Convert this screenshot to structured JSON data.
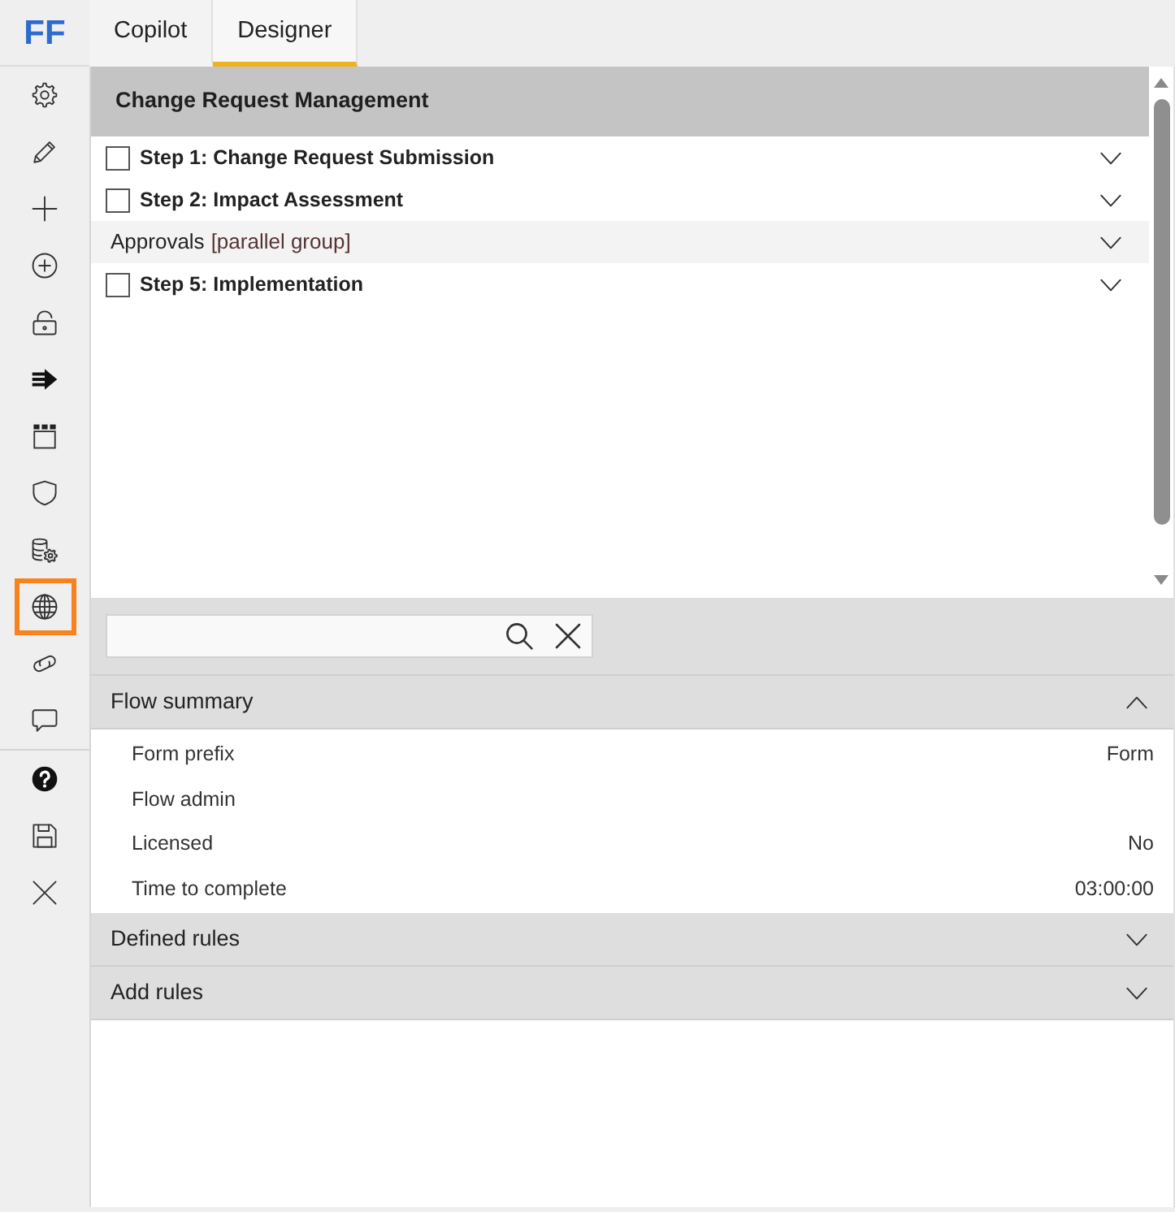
{
  "logo": {
    "text": "FF"
  },
  "tabs": [
    {
      "label": "Copilot",
      "selected": false
    },
    {
      "label": "Designer",
      "selected": true
    }
  ],
  "sidebar": {
    "groups": [
      {
        "items": [
          {
            "kind": "settings",
            "selected": false
          },
          {
            "kind": "edit",
            "selected": false
          },
          {
            "kind": "add",
            "selected": false
          },
          {
            "kind": "insert",
            "selected": false
          },
          {
            "kind": "unlock",
            "selected": false
          },
          {
            "kind": "forward",
            "selected": false
          },
          {
            "kind": "calendar",
            "selected": false
          },
          {
            "kind": "shield",
            "selected": false
          },
          {
            "kind": "database",
            "selected": false
          },
          {
            "kind": "globe",
            "selected": true
          },
          {
            "kind": "link",
            "selected": false
          },
          {
            "kind": "comment",
            "selected": false
          }
        ]
      },
      {
        "items": [
          {
            "kind": "help",
            "selected": false
          },
          {
            "kind": "save",
            "selected": false
          },
          {
            "kind": "close",
            "selected": false
          }
        ]
      }
    ]
  },
  "flow": {
    "title": "Change Request Management",
    "items": [
      {
        "kind": "step",
        "label": "Step 1: Change Request Submission",
        "checked": false,
        "expanded": false
      },
      {
        "kind": "step",
        "label": "Step 2: Impact Assessment",
        "checked": false,
        "expanded": false
      },
      {
        "kind": "group",
        "label": "Approvals",
        "note": "[parallel group]",
        "expanded": false
      },
      {
        "kind": "step",
        "label": "Step 5: Implementation",
        "checked": false,
        "expanded": false
      }
    ]
  },
  "sections": [
    {
      "title": "Flow summary",
      "expanded": true,
      "rows": [
        {
          "label": "Form prefix",
          "value": "Form"
        },
        {
          "label": "Flow admin"
        },
        {
          "label": "Licensed",
          "value": "No"
        },
        {
          "label": "Time to complete",
          "value": "03:00:00"
        }
      ]
    },
    {
      "title": "Defined rules",
      "expanded": false
    },
    {
      "title": "Add rules",
      "expanded": false
    }
  ]
}
